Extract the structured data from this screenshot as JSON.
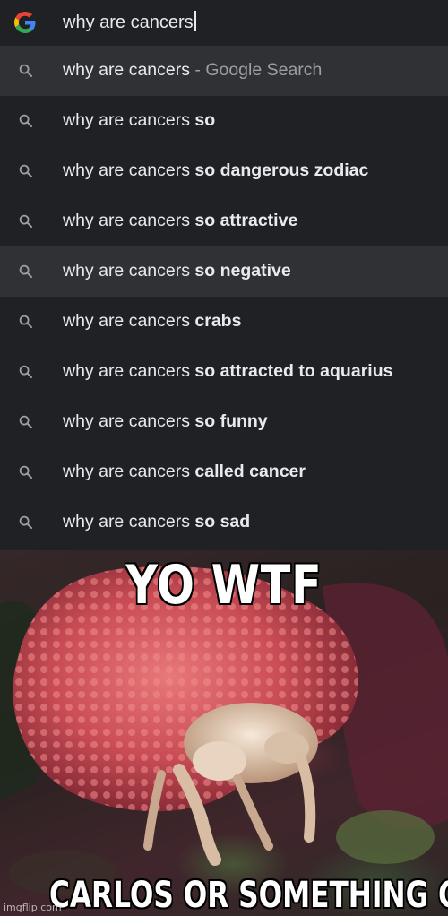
{
  "search": {
    "query": "why are cancers",
    "suggestions": [
      {
        "base": "why are cancers",
        "bold": "",
        "source": " - Google Search",
        "highlighted": true
      },
      {
        "base": "why are cancers",
        "bold": " so",
        "source": "",
        "highlighted": false
      },
      {
        "base": "why are cancers",
        "bold": " so dangerous zodiac",
        "source": "",
        "highlighted": false
      },
      {
        "base": "why are cancers",
        "bold": " so attractive",
        "source": "",
        "highlighted": false
      },
      {
        "base": "why are cancers",
        "bold": " so negative",
        "source": "",
        "highlighted": true
      },
      {
        "base": "why are cancers",
        "bold": " crabs",
        "source": "",
        "highlighted": false
      },
      {
        "base": "why are cancers",
        "bold": " so attracted to aquarius",
        "source": "",
        "highlighted": false
      },
      {
        "base": "why are cancers",
        "bold": " so funny",
        "source": "",
        "highlighted": false
      },
      {
        "base": "why are cancers",
        "bold": " called cancer",
        "source": "",
        "highlighted": false
      },
      {
        "base": "why are cancers",
        "bold": " so sad",
        "source": "",
        "highlighted": false
      }
    ]
  },
  "meme": {
    "top_caption": "YO WTF",
    "bottom_caption": "CARLOS OR SOMETHING CRAB",
    "watermark": "imgflip.com"
  },
  "colors": {
    "panel_bg": "#202124",
    "highlight_bg": "#303134",
    "text": "#e8eaed",
    "muted": "#9aa0a6",
    "google_blue": "#4285F4",
    "google_red": "#EA4335",
    "google_yellow": "#FBBC05",
    "google_green": "#34A853"
  },
  "icons": {
    "logo": "google-g-icon",
    "suggestion": "search-icon"
  }
}
